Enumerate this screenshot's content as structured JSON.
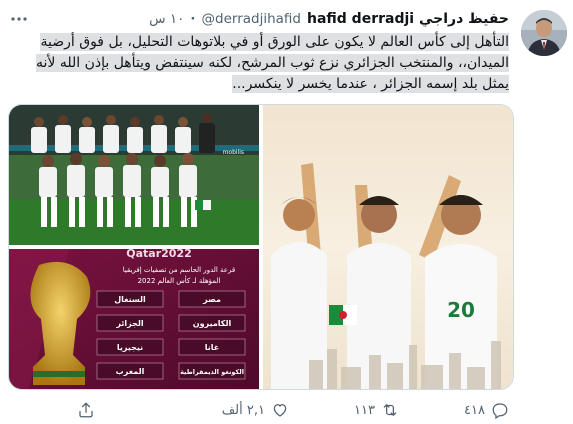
{
  "tweet": {
    "display_name": "حفيظ دراجي hafid derradji",
    "username": "@derradjihafid",
    "separator": "·",
    "time": "١٠ س",
    "text": "التأهل إلى كأس العالم لا يكون على الورق أو في بلاتوهات التحليل، بل فوق أرضية الميدان،، والمنتخب الجزائري نزع ثوب المرشح، لكنه سينتفض ويتأهل بإذن الله لأنه يمثل بلد إسمه الجزائر ، عندما يخسر لا ينكسر..."
  },
  "media": {
    "poster": {
      "title": "Qatar2022",
      "subtitle_1": "قرعة الدور الحاسم من تصفيات إفريقيا",
      "subtitle_2": "المؤهلة لـ كأس العالم 2022",
      "matchups": [
        {
          "home": "مصر",
          "away": "السنغال"
        },
        {
          "home": "الكاميرون",
          "away": "الجزائر"
        },
        {
          "home": "غانا",
          "away": "نيجيريا"
        },
        {
          "home": "الكونغو الديمقراطية",
          "away": "المغرب"
        }
      ]
    },
    "team_photo": {
      "jersey_number": "20"
    }
  },
  "actions": {
    "reply_count": "",
    "retweet_count": "١١٣",
    "like_count": "٤١٨",
    "quote_count": "٢,١ ألف"
  },
  "colors": {
    "text_secondary": "#536471",
    "highlight": "#dfe0e2",
    "pitch_green": "#2f7a2a",
    "poster_purple": "#6b1038",
    "border": "#cfd9de"
  }
}
